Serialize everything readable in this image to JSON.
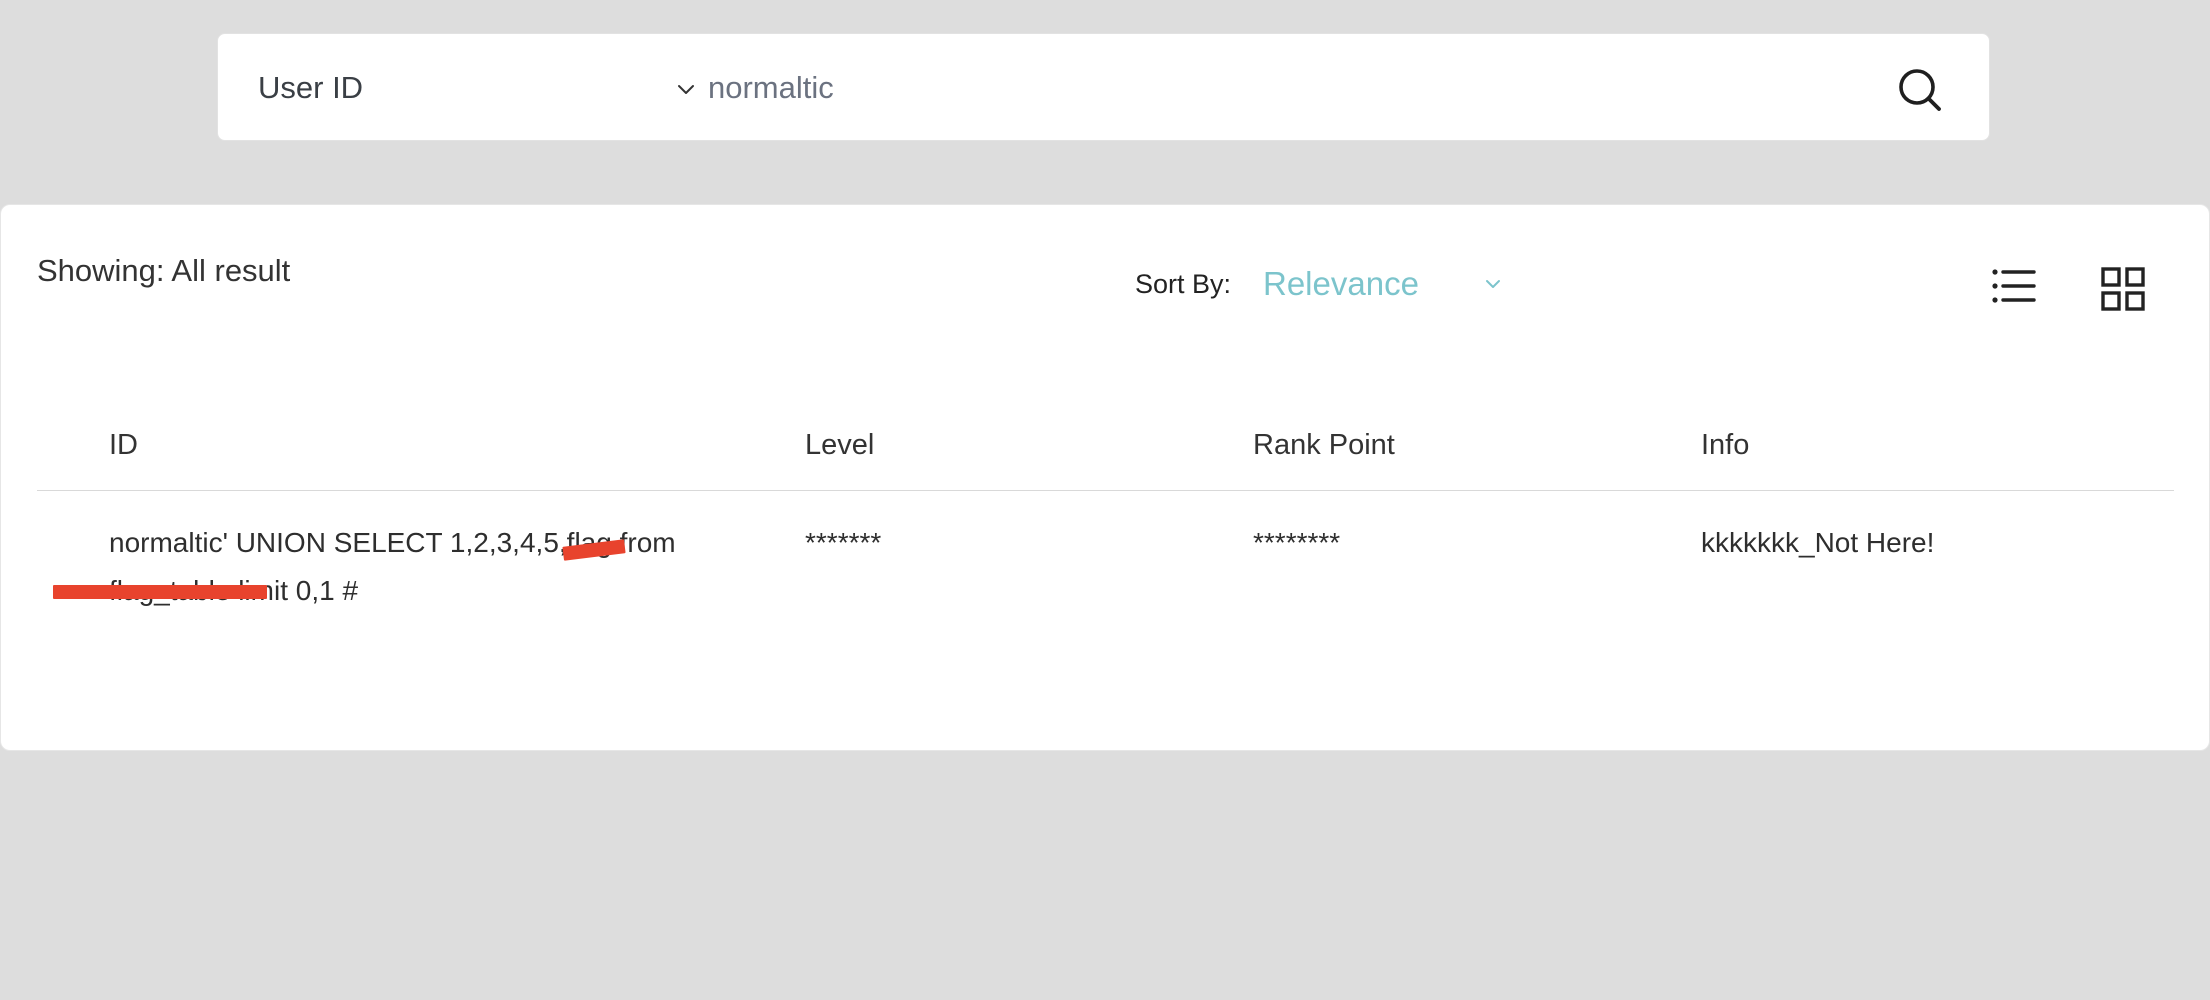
{
  "search": {
    "type_label": "User ID",
    "query": "normaltic",
    "icons": {
      "type_dropdown": "chevron-down-icon",
      "submit": "search-icon"
    }
  },
  "results": {
    "showing_text": "Showing: All result",
    "sort": {
      "label": "Sort By:",
      "selected": "Relevance",
      "icon": "chevron-down-icon"
    },
    "view_toggles": [
      "list-view-icon",
      "grid-view-icon"
    ],
    "columns": [
      "ID",
      "Level",
      "Rank Point",
      "Info"
    ],
    "rows": [
      {
        "id": "normaltic' UNION SELECT 1,2,3,4,5,flag from flag_table limit 0,1 #",
        "level": "*******",
        "rank_point": "********",
        "info": "kkkkkkk_Not Here!"
      }
    ]
  },
  "colors": {
    "background": "#dddddd",
    "panel": "#ffffff",
    "accent_sort": "#7cc4cc",
    "redaction": "#e8432d"
  }
}
